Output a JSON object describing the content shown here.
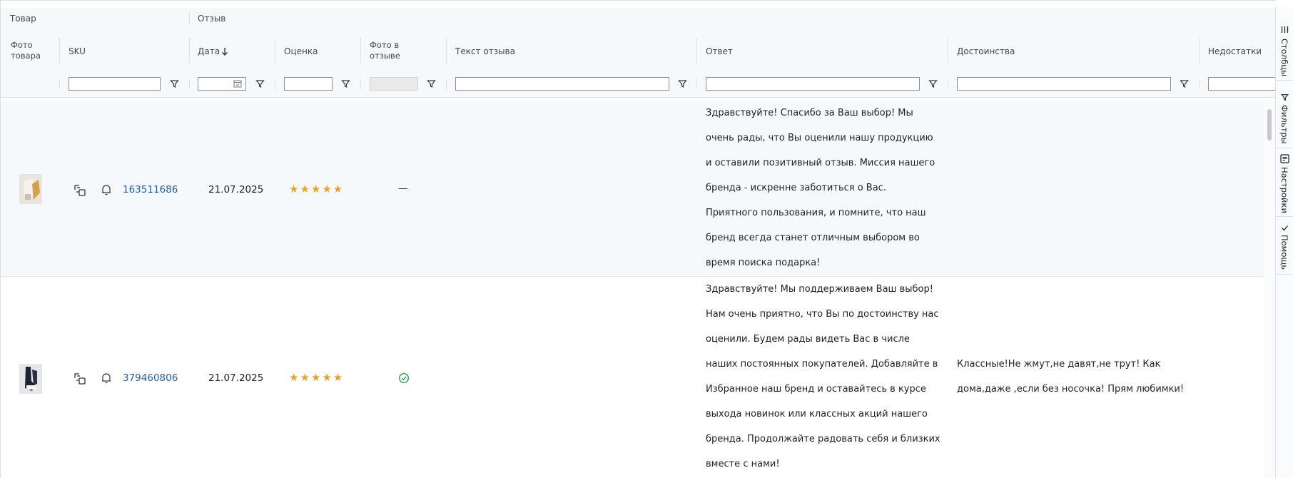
{
  "group_headers": {
    "product": "Товар",
    "review": "Отзыв"
  },
  "columns": {
    "photo": "Фото товара",
    "sku": "SKU",
    "date": "Дата",
    "rating": "Оценка",
    "review_photo": "Фото в отзыве",
    "review_text": "Текст отзыва",
    "answer": "Ответ",
    "advantages": "Достоинства",
    "disadvantages": "Недостатки"
  },
  "rows": [
    {
      "sku": "163511686",
      "date": "21.07.2025",
      "rating": 5,
      "review_photo": "—",
      "answer": "Здравствуйте! Спасибо за Ваш выбор! Мы очень рады, что Вы оценили нашу продукцию и оставили позитивный отзыв. Миссия нашего бренда - искренне заботиться о Вас. Приятного пользования, и помните, что наш бренд всегда станет отличным выбором во время поиска подарка!",
      "advantages": ""
    },
    {
      "sku": "379460806",
      "date": "21.07.2025",
      "rating": 5,
      "review_photo": "check-circle-icon",
      "answer": "Здравствуйте! Мы поддерживаем Ваш выбор! Нам очень приятно, что Вы по достоинству нас оценили. Будем рады видеть Вас в числе наших постоянных покупателей. Добавляйте в Избранное наш бренд и оставайтесь в курсе выхода новинок или классных акций нашего бренда. Продолжайте радовать себя и близких вместе с нами!",
      "advantages": "Классные!Не жмут,не давят,не трут! Как дома,даже ,если без носочка! Прям любимки!"
    }
  ],
  "side_panel": {
    "columns": "Столбцы",
    "filters": "Фильтры",
    "settings": "Настройки",
    "help": "Помощь"
  },
  "colors": {
    "link": "#1f5fa8",
    "star": "#f0a020",
    "check": "#2e9e4f"
  }
}
